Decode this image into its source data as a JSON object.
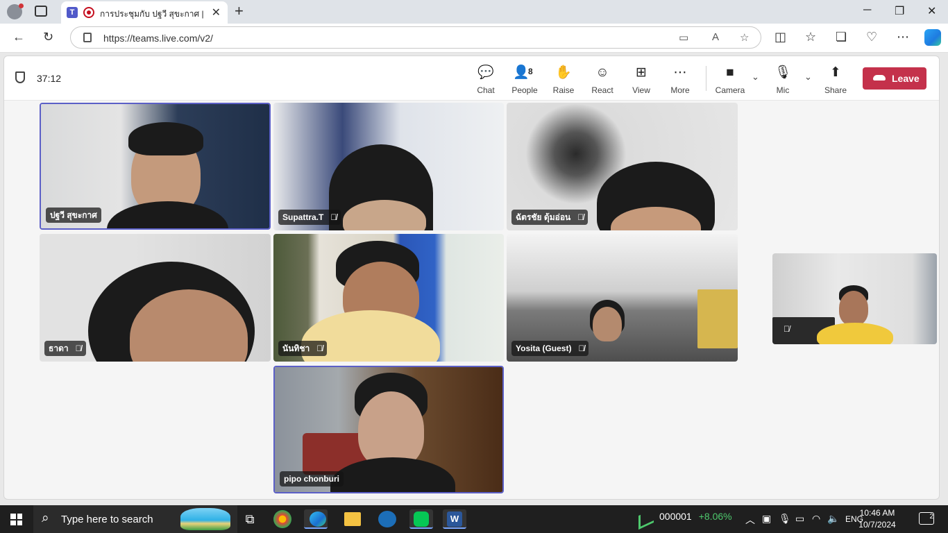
{
  "browser": {
    "tab_title": "การประชุมกับ ปฐวี สุขะกาศ | Mic",
    "tab_favicon_text": "T",
    "url": "https://teams.live.com/v2/",
    "new_tab": "+",
    "window_controls": {
      "minimize": "─",
      "restore": "❐",
      "close": "✕"
    }
  },
  "meeting": {
    "timer": "37:12",
    "toolbar": {
      "chat": "Chat",
      "people": "People",
      "people_count": "8",
      "raise": "Raise",
      "react": "React",
      "view": "View",
      "more": "More",
      "camera": "Camera",
      "mic": "Mic",
      "share": "Share",
      "leave": "Leave"
    },
    "participants": [
      {
        "name": "ปฐวี สุขะกาศ",
        "muted": false,
        "active": true
      },
      {
        "name": "Supattra.T",
        "muted": true,
        "active": false
      },
      {
        "name": "ฉัตรชัย ดุ้มอ่อน",
        "muted": true,
        "active": false
      },
      {
        "name": "ธาดา",
        "muted": true,
        "active": false
      },
      {
        "name": "นันทิชา",
        "muted": true,
        "active": false
      },
      {
        "name": "Yosita (Guest)",
        "muted": true,
        "active": false
      },
      {
        "name": "pipo chonburi",
        "muted": false,
        "active": true
      }
    ]
  },
  "taskbar": {
    "search_placeholder": "Type here to search",
    "stock_name": "000001",
    "stock_change": "+8.06%",
    "language": "ENG",
    "time": "10:46 AM",
    "date": "10/7/2024",
    "notification_count": "2"
  },
  "colors": {
    "accent": "#5b5fc7",
    "leave": "#c4314b",
    "taskbar": "#1f1f1f"
  }
}
